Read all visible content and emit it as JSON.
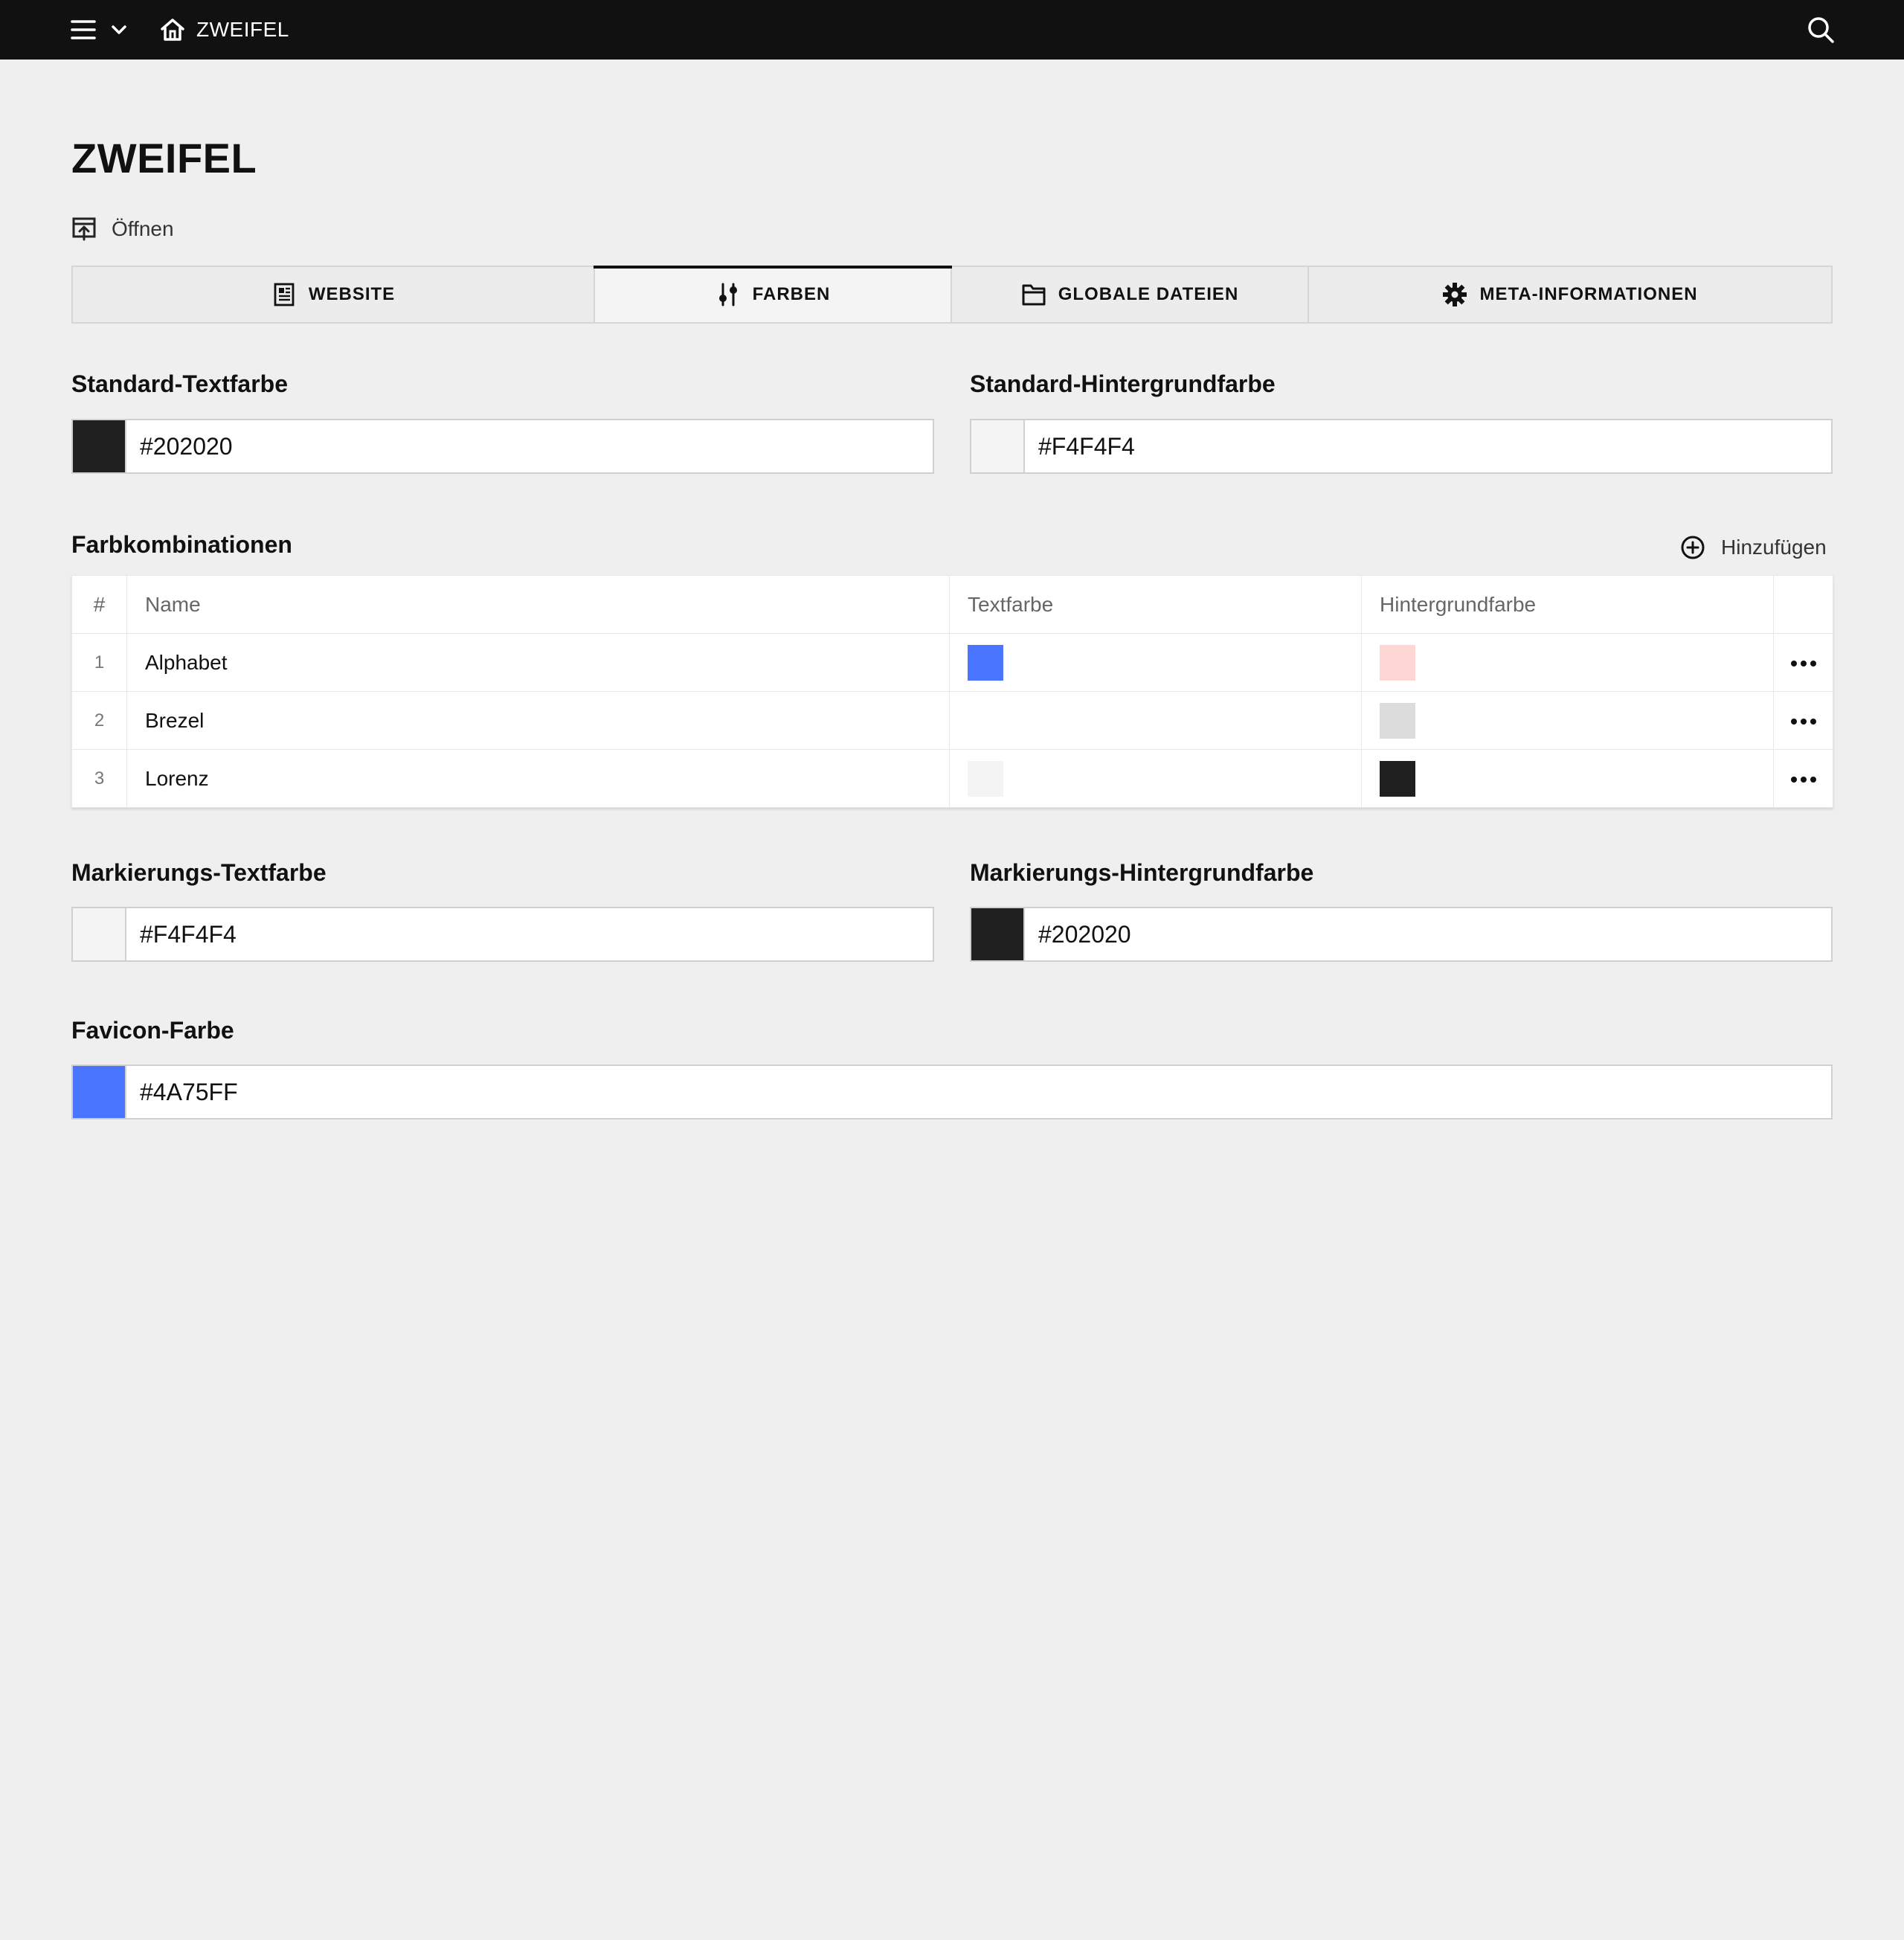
{
  "topbar": {
    "title": "ZWEIFEL",
    "icons": {
      "menu": "hamburger-menu-icon",
      "dropdown": "chevron-down-icon",
      "home": "home-icon",
      "search": "search-icon"
    }
  },
  "page": {
    "title": "ZWEIFEL",
    "open_label": "Öffnen"
  },
  "tabs": [
    {
      "label": "WEBSITE",
      "icon": "document-icon",
      "active": false
    },
    {
      "label": "FARBEN",
      "icon": "sliders-icon",
      "active": true
    },
    {
      "label": "GLOBALE DATEIEN",
      "icon": "folder-icon",
      "active": false
    },
    {
      "label": "META-INFORMATIONEN",
      "icon": "gear-icon",
      "active": false
    }
  ],
  "fields": {
    "standard_text": {
      "label": "Standard-Textfarbe",
      "value": "#202020",
      "swatch": "#202020"
    },
    "standard_bg": {
      "label": "Standard-Hintergrundfarbe",
      "value": "#F4F4F4",
      "swatch": "#F4F4F4"
    },
    "highlight_text": {
      "label": "Markierungs-Textfarbe",
      "value": "#F4F4F4",
      "swatch": "#F4F4F4"
    },
    "highlight_bg": {
      "label": "Markierungs-Hintergrundfarbe",
      "value": "#202020",
      "swatch": "#202020"
    },
    "favicon": {
      "label": "Favicon-Farbe",
      "value": "#4A75FF",
      "swatch": "#4A75FF"
    }
  },
  "combos": {
    "title": "Farbkombinationen",
    "add_label": "Hinzufügen",
    "headers": {
      "num": "#",
      "name": "Name",
      "text": "Textfarbe",
      "bg": "Hintergrundfarbe"
    },
    "rows": [
      {
        "num": "1",
        "name": "Alphabet",
        "text_color": "#4A75FF",
        "bg_color": "#FFD6D6"
      },
      {
        "num": "2",
        "name": "Brezel",
        "text_color": "",
        "bg_color": "#DCDCDC"
      },
      {
        "num": "3",
        "name": "Lorenz",
        "text_color": "#F4F4F4",
        "bg_color": "#202020"
      }
    ]
  }
}
